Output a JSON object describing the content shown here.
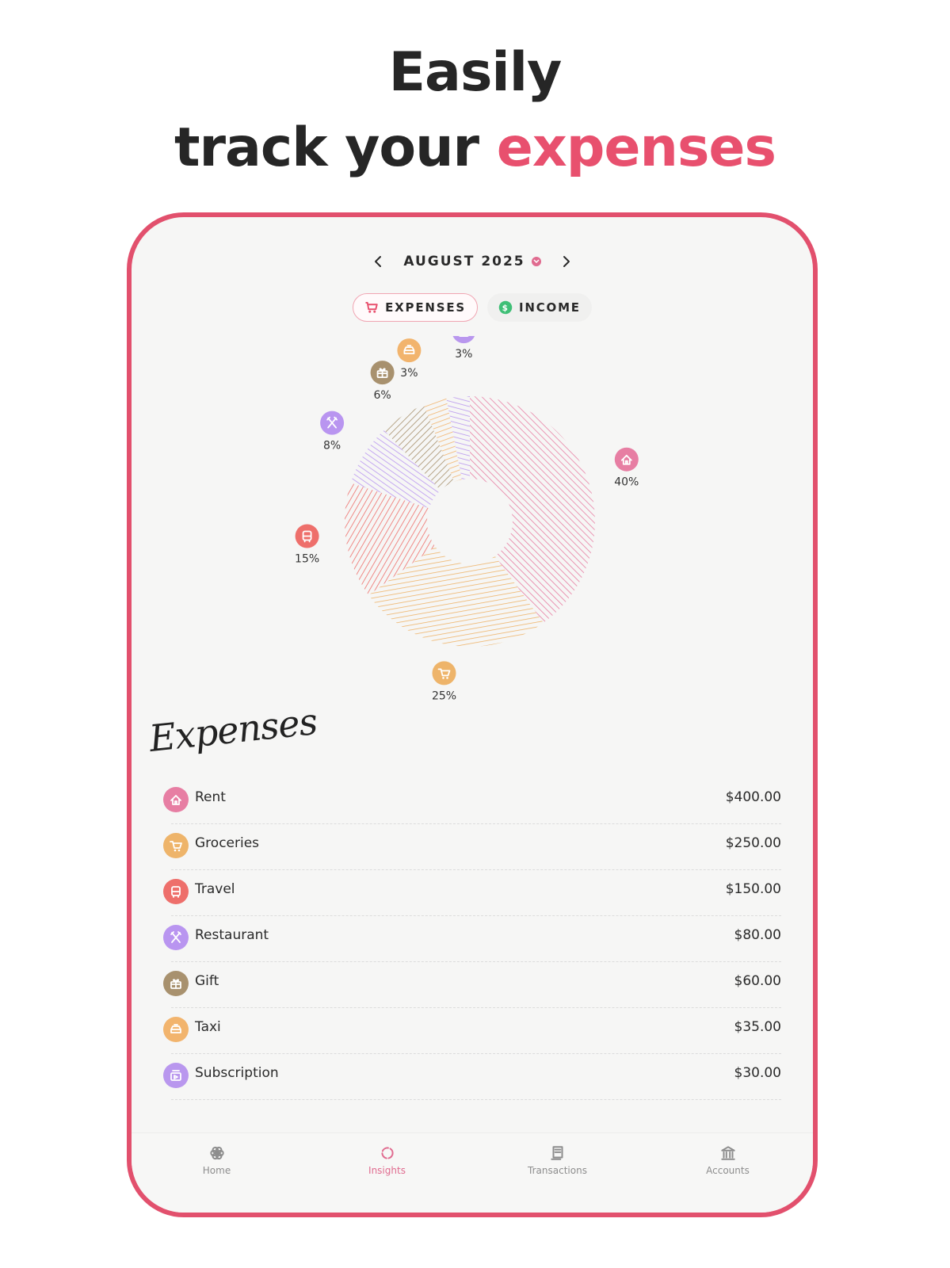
{
  "headline": {
    "line1": "Easily",
    "line2_prefix": "track your ",
    "line2_accent": "expenses"
  },
  "month_nav": {
    "label": "AUGUST 2025"
  },
  "toggle": {
    "expenses_label": "EXPENSES",
    "income_label": "INCOME"
  },
  "chart_data": {
    "type": "pie",
    "categories": [
      "Rent",
      "Groceries",
      "Travel",
      "Restaurant",
      "Gift",
      "Taxi",
      "Subscription"
    ],
    "values": [
      40,
      25,
      15,
      8,
      6,
      3,
      3
    ],
    "labels": [
      "40%",
      "25%",
      "15%",
      "8%",
      "6%",
      "3%",
      "3%"
    ],
    "colors": [
      "#e77ea3",
      "#eeb46a",
      "#ee6f6b",
      "#b995f0",
      "#a8916e",
      "#f2b46d",
      "#b997ee"
    ],
    "icons": [
      "house-icon",
      "cart-icon",
      "bus-icon",
      "utensils-icon",
      "gift-icon",
      "taxi-icon",
      "subscription-icon"
    ]
  },
  "list": {
    "title": "Expenses",
    "items": [
      {
        "name": "Rent",
        "amount": "$400.00",
        "icon": "house-icon",
        "color": "#e77ea3"
      },
      {
        "name": "Groceries",
        "amount": "$250.00",
        "icon": "cart-icon",
        "color": "#eeb46a"
      },
      {
        "name": "Travel",
        "amount": "$150.00",
        "icon": "bus-icon",
        "color": "#ee6f6b"
      },
      {
        "name": "Restaurant",
        "amount": "$80.00",
        "icon": "utensils-icon",
        "color": "#b995f0"
      },
      {
        "name": "Gift",
        "amount": "$60.00",
        "icon": "gift-icon",
        "color": "#a8916e"
      },
      {
        "name": "Taxi",
        "amount": "$35.00",
        "icon": "taxi-icon",
        "color": "#f2b46d"
      },
      {
        "name": "Subscription",
        "amount": "$30.00",
        "icon": "subscription-icon",
        "color": "#b997ee"
      }
    ]
  },
  "tabbar": {
    "tabs": [
      {
        "label": "Home",
        "icon": "flower-icon"
      },
      {
        "label": "Insights",
        "icon": "ring-icon"
      },
      {
        "label": "Transactions",
        "icon": "receipt-icon"
      },
      {
        "label": "Accounts",
        "icon": "bank-icon"
      }
    ],
    "active_index": 1,
    "accent": "#e06b8f"
  },
  "colors": {
    "brand": "#e2506d",
    "accent_text": "#e8506e"
  }
}
